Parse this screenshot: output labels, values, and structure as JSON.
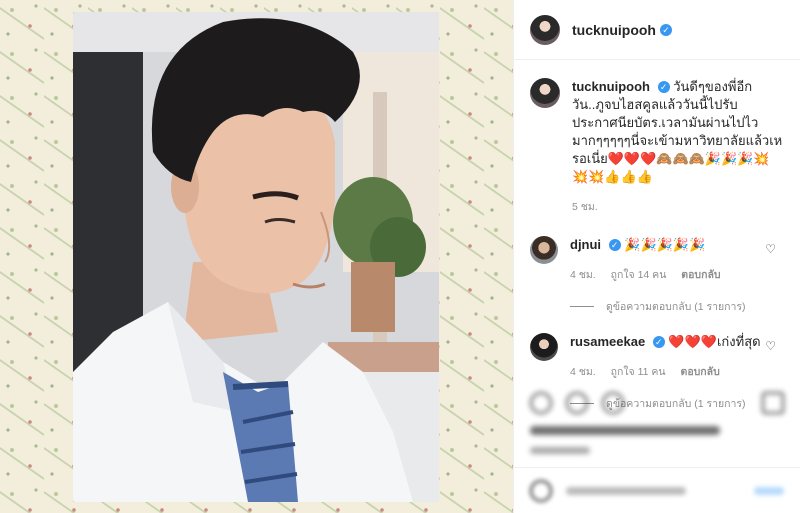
{
  "post": {
    "owner_username": "tucknuipooh",
    "verified_glyph": "✓",
    "caption": "วันดีๆของพี่อีกวัน..ภูจบไฮสคูลแล้ววันนี้ไปรับประกาศนียบัตร.เวลามันผ่านไปไวมากๆๆๆๆๆนี่จะเข้ามหาวิทยาลัยแล้วเหรอเนี่ย❤️❤️❤️🙈🙈🙈🎉🎉🎉💥💥💥👍👍👍",
    "caption_time": "5 ชม."
  },
  "comments": [
    {
      "username": "djnui",
      "text": "🎉🎉🎉🎉🎉",
      "time": "4 ชม.",
      "likes": "ถูกใจ 14 คน",
      "reply_label": "ตอบกลับ",
      "view_replies": "ดูข้อความตอบกลับ (1 รายการ)",
      "avatar_icon": "avatar-djnui"
    },
    {
      "username": "rusameekae",
      "text": "❤️❤️❤️เก่งที่สุด",
      "time": "4 ชม.",
      "likes": "ถูกใจ 11 คน",
      "reply_label": "ตอบกลับ",
      "view_replies": "ดูข้อความตอบกลับ (1 รายการ)",
      "avatar_icon": "avatar-rusameekae"
    }
  ],
  "icons": {
    "heart": "♡",
    "verified": "verified-badge-icon"
  },
  "colors": {
    "verified_blue": "#3897f0",
    "meta_gray": "#8e8e8e",
    "background_pattern": "#f3eedb"
  }
}
